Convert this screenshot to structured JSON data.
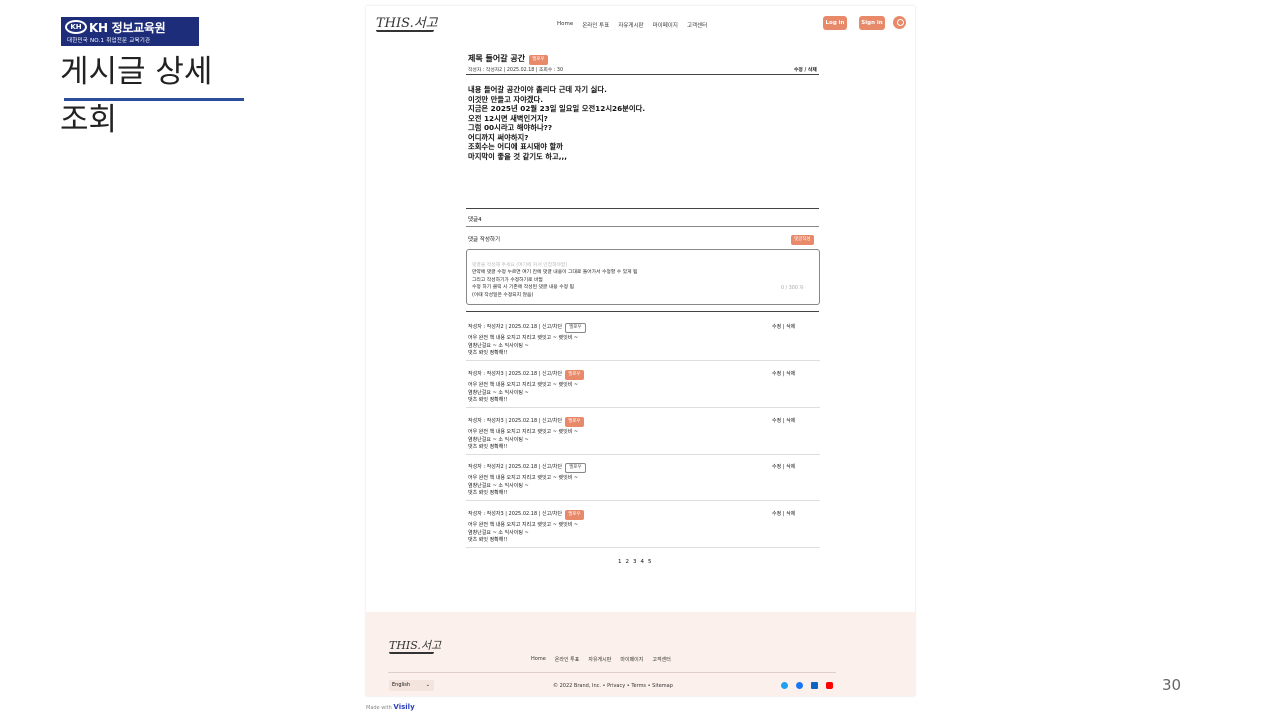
{
  "slide": {
    "logo_mark": "KH",
    "logo_name": "KH 정보교육원",
    "logo_tagline": "대한민국 NO.1 취업전문 교육기관",
    "title_line1": "게시글 상세",
    "title_line2": "조회",
    "page_number": "30",
    "accent_color": "#2b4d9b"
  },
  "site": {
    "brand": "THIS.서고",
    "nav": [
      "Home",
      "온라인 투표",
      "자유게시판",
      "마이페이지",
      "고객센터"
    ],
    "login_label": "Log in",
    "signin_label": "Sign in",
    "accent_color": "#e8896a"
  },
  "post": {
    "title": "제목 들어갈 공간",
    "badge": "엘로우",
    "meta": "작성자 : 작성자2 | 2025.02.18 | 조회수 : 30",
    "actions": "수정 / 삭제",
    "body": "내용 들어갈 공간이야 졸리다 근데 자기 싫다.\n이것만 만들고 자야겠다.\n지금은 2025년 02월 23일 일요일 오전12시26분이다.\n오전 12시면 새벽인거지?\n그럼 00시라고 해야하나??\n어디까지 써야하지?\n조회수는 어디에 표시돼야 할까\n마지막이 좋을 것 같기도 하고,,,"
  },
  "comments_section": {
    "count_label": "댓글4",
    "write_label": "댓글 작성하기",
    "write_button": "댓글작성",
    "placeholder": "댓글을 작성해 주세요 (여기에 커서 안잡혀야함)",
    "draft_text": "만약에 댓글 수정 누르면 여기 칸에 댓글 내용이 그대로 들어가서 수정할 수 있게 됨\n그리고 작성하기가 수정하기로 바뀜\n수정 하기 클릭 시 기존에 작성된 댓글 내용 수정 됨\n(이때 작성일은 수정되지 않음)",
    "char_count": "0 / 300 자"
  },
  "comments": [
    {
      "meta": "작성자 : 작성자2 | 2025.02.18 | 신고/차단",
      "badge": "엘로우",
      "badge_style": "outline",
      "actions": "수정 | 삭제",
      "body": "어우 완전 책 내용 오지고 지리고 렛잇고 ~ 렛잇비 ~\n염창난걸요 ~ 소 익사이팅 ~\n댓츠 롸잇 정확해!!"
    },
    {
      "meta": "작성자 : 작성자3 | 2025.02.18 | 신고/차단",
      "badge": "엘로우",
      "badge_style": "filled",
      "actions": "수정 | 삭제",
      "body": "어우 완전 책 내용 오지고 지리고 렛잇고 ~ 렛잇비 ~\n염창난걸요 ~ 소 익사이팅 ~\n댓츠 롸잇 정확해!!"
    },
    {
      "meta": "작성자 : 작성자3 | 2025.02.18 | 신고/차단",
      "badge": "엘로우",
      "badge_style": "filled",
      "actions": "수정 | 삭제",
      "body": "어우 완전 책 내용 오지고 지리고 렛잇고 ~ 렛잇비 ~\n염창난걸요 ~ 소 익사이팅 ~\n댓츠 롸잇 정확해!!"
    },
    {
      "meta": "작성자 : 작성자2 | 2025.02.18 | 신고/차단",
      "badge": "엘로우",
      "badge_style": "outline",
      "actions": "수정 | 삭제",
      "body": "어우 완전 책 내용 오지고 지리고 렛잇고 ~ 렛잇비 ~\n염창난걸요 ~ 소 익사이팅 ~\n댓츠 롸잇 정확해!!"
    },
    {
      "meta": "작성자 : 작성자3 | 2025.02.18 | 신고/차단",
      "badge": "엘로우",
      "badge_style": "filled",
      "actions": "수정 | 삭제",
      "body": "어우 완전 책 내용 오지고 지리고 렛잇고 ~ 렛잇비 ~\n염창난걸요 ~ 소 익사이팅 ~\n댓츠 롸잇 정확해!!"
    }
  ],
  "pagination": [
    "1",
    "2",
    "3",
    "4",
    "5"
  ],
  "footer": {
    "brand": "THIS.서고",
    "links": [
      "Home",
      "온라인 투표",
      "자유게시판",
      "마이페이지",
      "고객센터"
    ],
    "language": "English",
    "copyright": "© 2022 Brand, Inc. • Privacy • Terms • Sitemap",
    "social_icons": [
      "twitter-icon",
      "facebook-icon",
      "linkedin-icon",
      "youtube-icon"
    ],
    "background_color": "#fbf0ec"
  },
  "made_with": {
    "prefix": "Made with",
    "brand": "Visily"
  }
}
